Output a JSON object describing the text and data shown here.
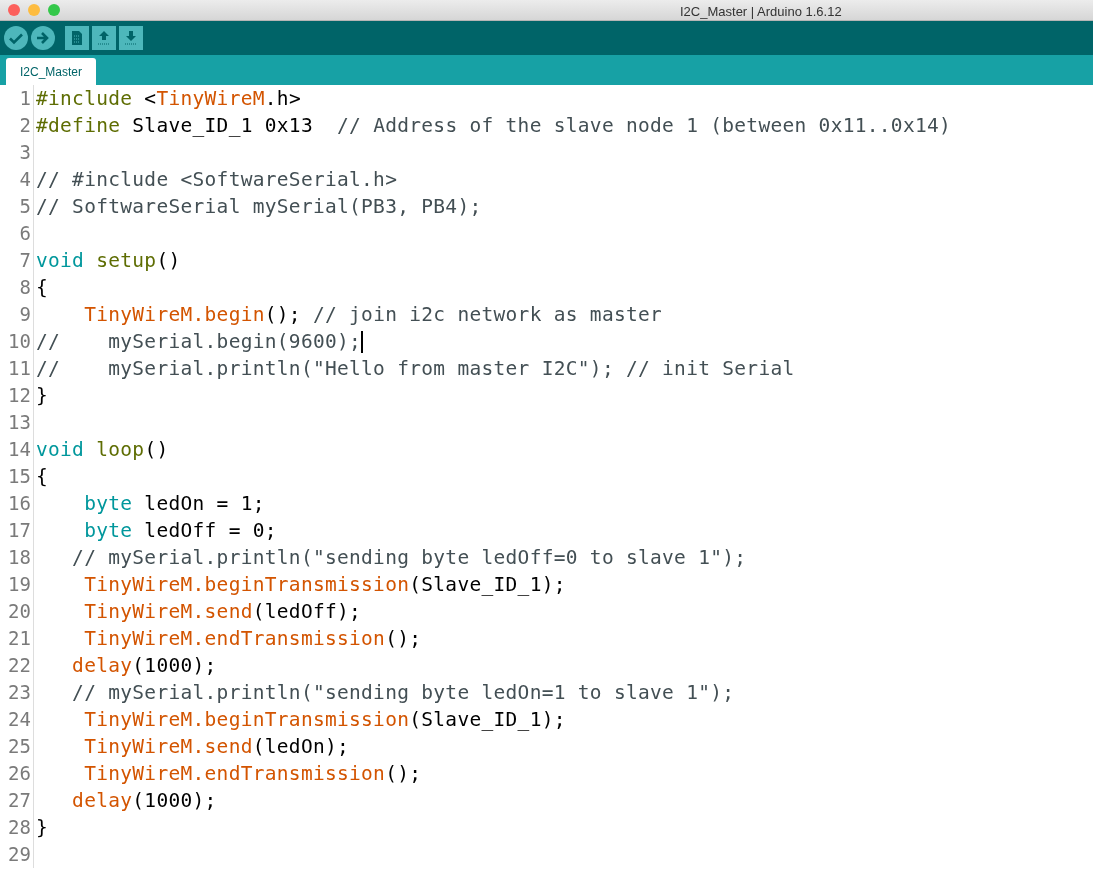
{
  "window": {
    "title": "I2C_Master | Arduino 1.6.12"
  },
  "tabs": [
    {
      "label": "I2C_Master",
      "selected": true
    }
  ],
  "code_lines": [
    {
      "number": "1",
      "caret": false,
      "tokens": [
        {
          "kind": "preproc",
          "text": "#include"
        },
        {
          "kind": "plain",
          "text": " <"
        },
        {
          "kind": "library",
          "text": "TinyWireM"
        },
        {
          "kind": "plain",
          "text": ".h>"
        }
      ]
    },
    {
      "number": "2",
      "caret": false,
      "tokens": [
        {
          "kind": "preproc",
          "text": "#define"
        },
        {
          "kind": "plain",
          "text": " Slave_ID_1 0x13  "
        },
        {
          "kind": "comment",
          "text": "// Address of the slave node 1 (between 0x11..0x14)"
        }
      ]
    },
    {
      "number": "3",
      "caret": false
    },
    {
      "number": "4",
      "caret": false,
      "tokens": [
        {
          "kind": "comment",
          "text": "// #include <SoftwareSerial.h>"
        }
      ]
    },
    {
      "number": "5",
      "caret": false,
      "tokens": [
        {
          "kind": "comment",
          "text": "// SoftwareSerial mySerial(PB3, PB4);"
        }
      ]
    },
    {
      "number": "6",
      "caret": false
    },
    {
      "number": "7",
      "caret": false,
      "tokens": [
        {
          "kind": "keyword",
          "text": "void"
        },
        {
          "kind": "function",
          "text": " setup"
        },
        {
          "kind": "plain",
          "text": "()"
        }
      ]
    },
    {
      "number": "8",
      "caret": false,
      "tokens": [
        {
          "kind": "plain",
          "text": "{"
        }
      ]
    },
    {
      "number": "9",
      "caret": false,
      "tokens": [
        {
          "kind": "library",
          "text": "    TinyWireM.begin"
        },
        {
          "kind": "plain",
          "text": "(); "
        },
        {
          "kind": "comment",
          "text": "// join i2c network as master"
        }
      ]
    },
    {
      "number": "10",
      "caret": true,
      "tokens": [
        {
          "kind": "comment",
          "text": "//    mySerial.begin(9600);"
        }
      ]
    },
    {
      "number": "11",
      "caret": false,
      "tokens": [
        {
          "kind": "comment",
          "text": "//    mySerial.println(\"Hello from master I2C\"); // init Serial"
        }
      ]
    },
    {
      "number": "12",
      "caret": false,
      "tokens": [
        {
          "kind": "plain",
          "text": "}"
        }
      ]
    },
    {
      "number": "13",
      "caret": false
    },
    {
      "number": "14",
      "caret": false,
      "tokens": [
        {
          "kind": "keyword",
          "text": "void"
        },
        {
          "kind": "function",
          "text": " loop"
        },
        {
          "kind": "plain",
          "text": "()"
        }
      ]
    },
    {
      "number": "15",
      "caret": false,
      "tokens": [
        {
          "kind": "plain",
          "text": "{"
        }
      ]
    },
    {
      "number": "16",
      "caret": false,
      "tokens": [
        {
          "kind": "keyword",
          "text": "    byte"
        },
        {
          "kind": "plain",
          "text": " ledOn = 1;"
        }
      ]
    },
    {
      "number": "17",
      "caret": false,
      "tokens": [
        {
          "kind": "keyword",
          "text": "    byte"
        },
        {
          "kind": "plain",
          "text": " ledOff = 0;"
        }
      ]
    },
    {
      "number": "18",
      "caret": false,
      "tokens": [
        {
          "kind": "comment",
          "text": "   // mySerial.println(\"sending byte ledOff=0 to slave 1\");"
        }
      ]
    },
    {
      "number": "19",
      "caret": false,
      "tokens": [
        {
          "kind": "library",
          "text": "    TinyWireM.beginTransmission"
        },
        {
          "kind": "plain",
          "text": "(Slave_ID_1);"
        }
      ]
    },
    {
      "number": "20",
      "caret": false,
      "tokens": [
        {
          "kind": "library",
          "text": "    TinyWireM.send"
        },
        {
          "kind": "plain",
          "text": "(ledOff);"
        }
      ]
    },
    {
      "number": "21",
      "caret": false,
      "tokens": [
        {
          "kind": "library",
          "text": "    TinyWireM.endTransmission"
        },
        {
          "kind": "plain",
          "text": "();"
        }
      ]
    },
    {
      "number": "22",
      "caret": false,
      "tokens": [
        {
          "kind": "library",
          "text": "   delay"
        },
        {
          "kind": "plain",
          "text": "(1000);"
        }
      ]
    },
    {
      "number": "23",
      "caret": false,
      "tokens": [
        {
          "kind": "comment",
          "text": "   // mySerial.println(\"sending byte ledOn=1 to slave 1\");"
        }
      ]
    },
    {
      "number": "24",
      "caret": false,
      "tokens": [
        {
          "kind": "library",
          "text": "    TinyWireM.beginTransmission"
        },
        {
          "kind": "plain",
          "text": "(Slave_ID_1);"
        }
      ]
    },
    {
      "number": "25",
      "caret": false,
      "tokens": [
        {
          "kind": "library",
          "text": "    TinyWireM.send"
        },
        {
          "kind": "plain",
          "text": "(ledOn);"
        }
      ]
    },
    {
      "number": "26",
      "caret": false,
      "tokens": [
        {
          "kind": "library",
          "text": "    TinyWireM.endTransmission"
        },
        {
          "kind": "plain",
          "text": "();"
        }
      ]
    },
    {
      "number": "27",
      "caret": false,
      "tokens": [
        {
          "kind": "library",
          "text": "   delay"
        },
        {
          "kind": "plain",
          "text": "(1000);"
        }
      ]
    },
    {
      "number": "28",
      "caret": false,
      "tokens": [
        {
          "kind": "plain",
          "text": "}"
        }
      ]
    },
    {
      "number": "29",
      "caret": false
    }
  ]
}
